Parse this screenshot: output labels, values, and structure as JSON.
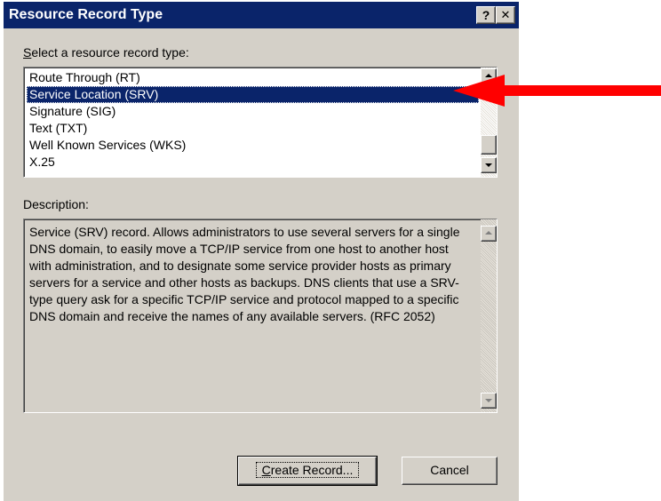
{
  "window": {
    "title": "Resource Record Type",
    "help_button": "?",
    "close_button": "✕"
  },
  "select_label_prefix": "S",
  "select_label_rest": "elect a resource record type:",
  "record_types": [
    "Route Through (RT)",
    "Service Location (SRV)",
    "Signature (SIG)",
    "Text (TXT)",
    "Well Known Services (WKS)",
    "X.25"
  ],
  "selected_record_type": "Service Location (SRV)",
  "description_label": "Description:",
  "description_text": "Service (SRV) record. Allows administrators to use several servers for a single DNS domain, to easily move a TCP/IP service from one host to another host with administration, and to designate some service provider hosts as primary servers for a service and other hosts as backups. DNS clients that use a SRV-type query ask for a specific TCP/IP service and protocol mapped to a specific DNS domain and receive the names of any available servers. (RFC 2052)",
  "buttons": {
    "create_prefix": "C",
    "create_rest": "reate Record...",
    "cancel": "Cancel"
  },
  "colors": {
    "selection": "#0a246a",
    "annotation_arrow": "#ff0000"
  }
}
